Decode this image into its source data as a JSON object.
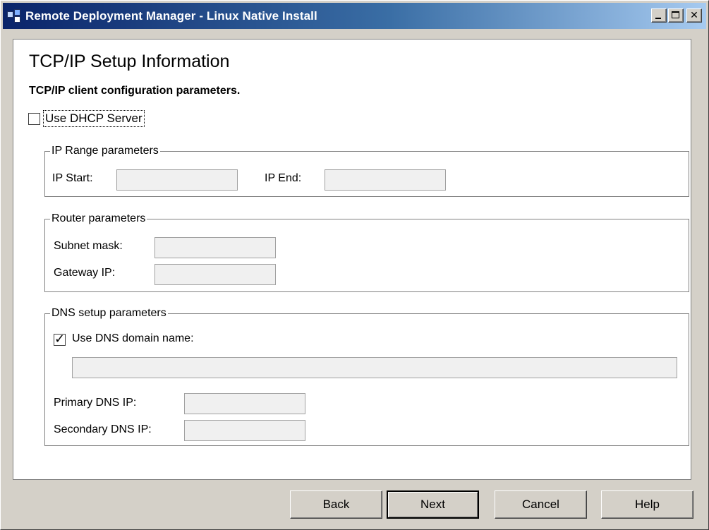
{
  "window": {
    "title": "Remote Deployment Manager - Linux Native Install"
  },
  "page": {
    "title": "TCP/IP Setup Information",
    "subtitle": "TCP/IP client configuration parameters."
  },
  "dhcp": {
    "label": "Use DHCP Server",
    "checked": false
  },
  "ip_range": {
    "legend": "IP Range parameters",
    "start_label": "IP Start:",
    "start_value": "",
    "end_label": "IP End:",
    "end_value": ""
  },
  "router": {
    "legend": "Router parameters",
    "subnet_label": "Subnet mask:",
    "subnet_value": "",
    "gateway_label": "Gateway IP:",
    "gateway_value": ""
  },
  "dns": {
    "legend": "DNS setup parameters",
    "use_domain_label": "Use DNS domain name:",
    "use_domain_checked": true,
    "domain_value": "",
    "primary_label": "Primary DNS IP:",
    "primary_value": "",
    "secondary_label": "Secondary DNS IP:",
    "secondary_value": ""
  },
  "buttons": {
    "back": "Back",
    "next": "Next",
    "cancel": "Cancel",
    "help": "Help"
  },
  "icons": {
    "app": "app-icon",
    "minimize": "minimize-icon",
    "maximize": "maximize-icon",
    "close": "close-icon",
    "checkmark": "checkmark-icon"
  },
  "colors": {
    "titlebar_start": "#0a246a",
    "titlebar_end": "#a6caf0",
    "face": "#d4d0c8"
  }
}
